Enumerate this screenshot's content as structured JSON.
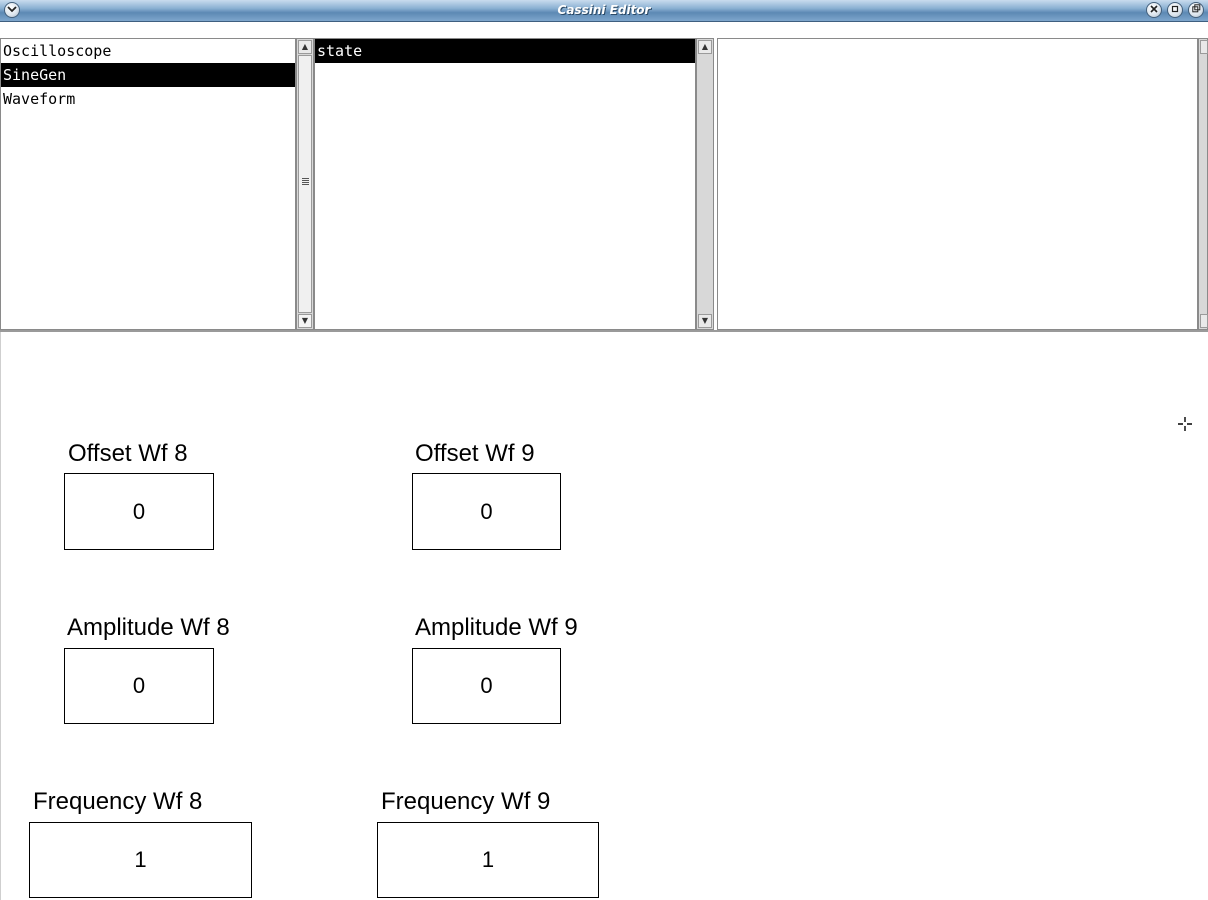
{
  "window": {
    "title": "Cassini Editor"
  },
  "titlebar": {
    "menu_icon": "chevron-down-icon",
    "close_icon": "close-icon",
    "minimize_icon": "minimize-icon",
    "maximize_icon": "maximize-icon"
  },
  "panes": {
    "modules": {
      "items": [
        "Oscilloscope",
        "SineGen",
        "Waveform"
      ],
      "selected": "SineGen"
    },
    "properties": {
      "items": [
        "state"
      ],
      "selected": "state"
    },
    "values": {
      "items": []
    }
  },
  "form": {
    "offset_wf8": {
      "label": "Offset Wf 8",
      "value": "0"
    },
    "offset_wf9": {
      "label": "Offset Wf 9",
      "value": "0"
    },
    "amplitude_wf8": {
      "label": "Amplitude Wf 8",
      "value": "0"
    },
    "amplitude_wf9": {
      "label": "Amplitude Wf 9",
      "value": "0"
    },
    "frequency_wf8": {
      "label": "Frequency Wf 8",
      "value": "1"
    },
    "frequency_wf9": {
      "label": "Frequency Wf 9",
      "value": "1"
    }
  },
  "colors": {
    "selection_bg": "#000000",
    "selection_fg": "#ffffff",
    "titlebar_accent": "#5d89b4"
  }
}
